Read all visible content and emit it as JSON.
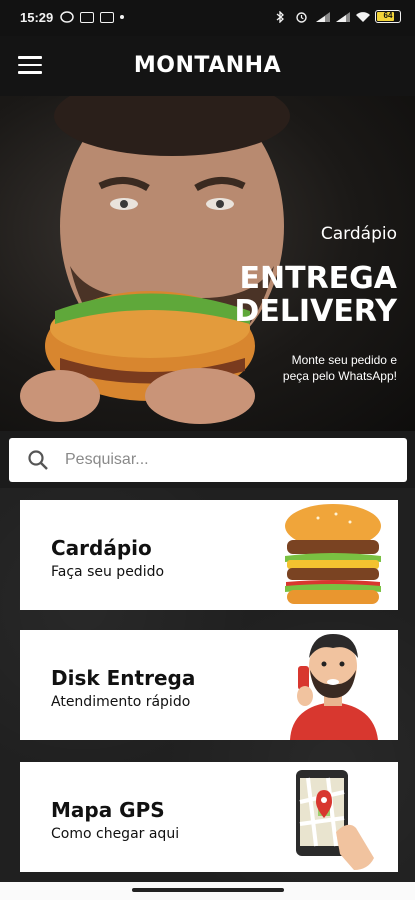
{
  "status_bar": {
    "time": "15:29",
    "battery": "64"
  },
  "header": {
    "brand": "MONTANHA"
  },
  "hero": {
    "subtitle": "Cardápio",
    "title_line1": "ENTREGA",
    "title_line2": "DELIVERY",
    "desc_line1": "Monte seu pedido e",
    "desc_line2": "peça pelo WhatsApp!"
  },
  "search": {
    "placeholder": "Pesquisar..."
  },
  "cards": [
    {
      "title": "Cardápio",
      "subtitle": "Faça seu pedido",
      "icon": "burger-icon"
    },
    {
      "title": "Disk Entrega",
      "subtitle": "Atendimento rápido",
      "icon": "phone-man-icon"
    },
    {
      "title": "Mapa GPS",
      "subtitle": "Como chegar aqui",
      "icon": "map-phone-icon"
    }
  ],
  "colors": {
    "header_bg": "#141414",
    "burger_bun": "#f0a53a",
    "accent_red": "#d8372f"
  }
}
